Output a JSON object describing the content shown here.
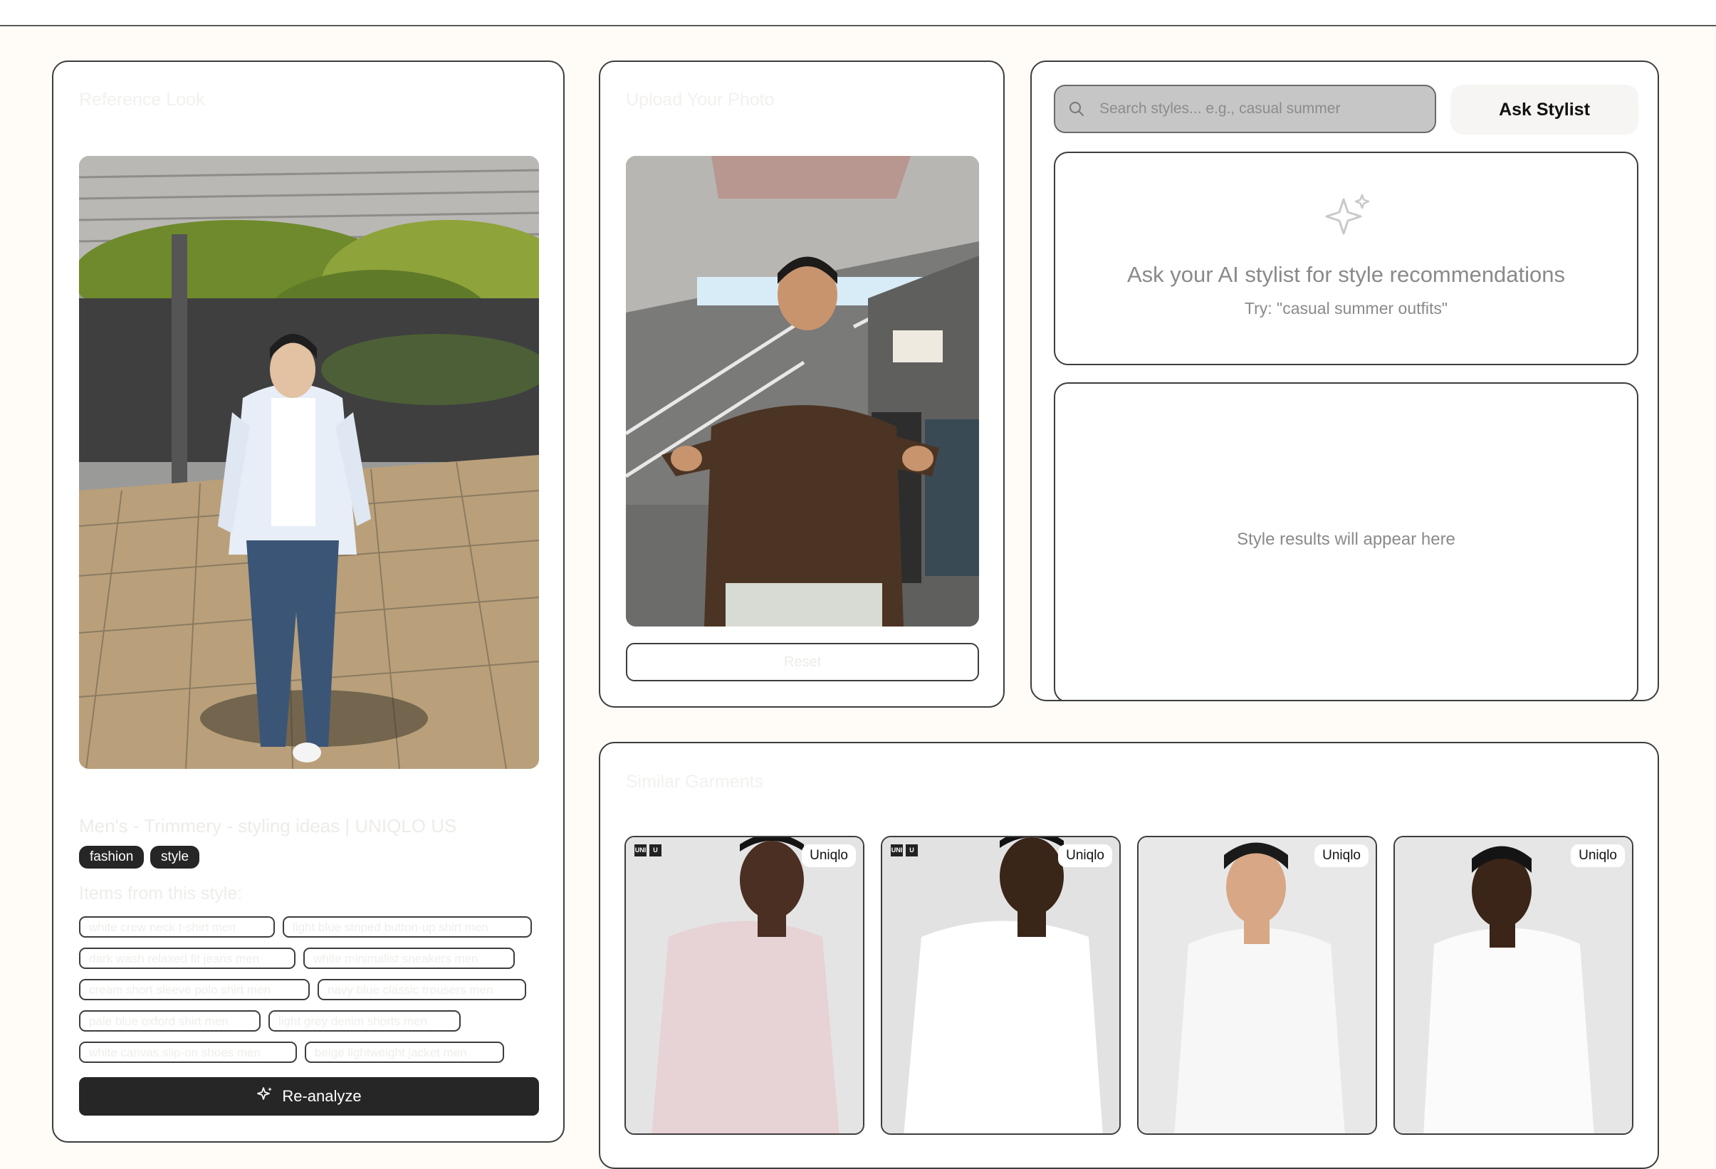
{
  "reference": {
    "heading": "Reference Look",
    "title": "Men's - Trimmery - styling ideas | UNIQLO US",
    "tags": [
      "fashion",
      "style"
    ],
    "items_heading": "Items from this style:",
    "items": [
      "white crew neck t-shirt men",
      "light blue striped button-up shirt men",
      "dark wash relaxed fit jeans men",
      "white minimalist sneakers men",
      "cream short sleeve polo shirt men",
      "navy blue classic trousers men",
      "pale blue oxford shirt men",
      "light grey denim shorts men",
      "white canvas slip-on shoes men",
      "beige lightweight jacket men"
    ],
    "reanalyze_label": "Re-analyze"
  },
  "upload": {
    "heading": "Upload Your Photo",
    "reset_label": "Reset"
  },
  "stylist": {
    "search_placeholder": "Search styles... e.g., casual summer",
    "ask_label": "Ask Stylist",
    "prompt_title": "Ask your AI stylist for style recommendations",
    "prompt_hint": "Try: \"casual summer outfits\"",
    "results_empty": "Style results will appear here"
  },
  "similar": {
    "heading": "Similar Garments",
    "products": [
      {
        "brand": "Uniqlo",
        "shirt_color": "#e7d2d5",
        "logo": true
      },
      {
        "brand": "Uniqlo",
        "shirt_color": "#ffffff",
        "logo": true
      },
      {
        "brand": "Uniqlo",
        "shirt_color": "#f7f7f7",
        "logo": false
      },
      {
        "brand": "Uniqlo",
        "shirt_color": "#fbfbfb",
        "logo": false
      }
    ]
  },
  "colors": {
    "background": "#fffcf7",
    "dark": "#262626",
    "border": "#3d3d3d"
  }
}
